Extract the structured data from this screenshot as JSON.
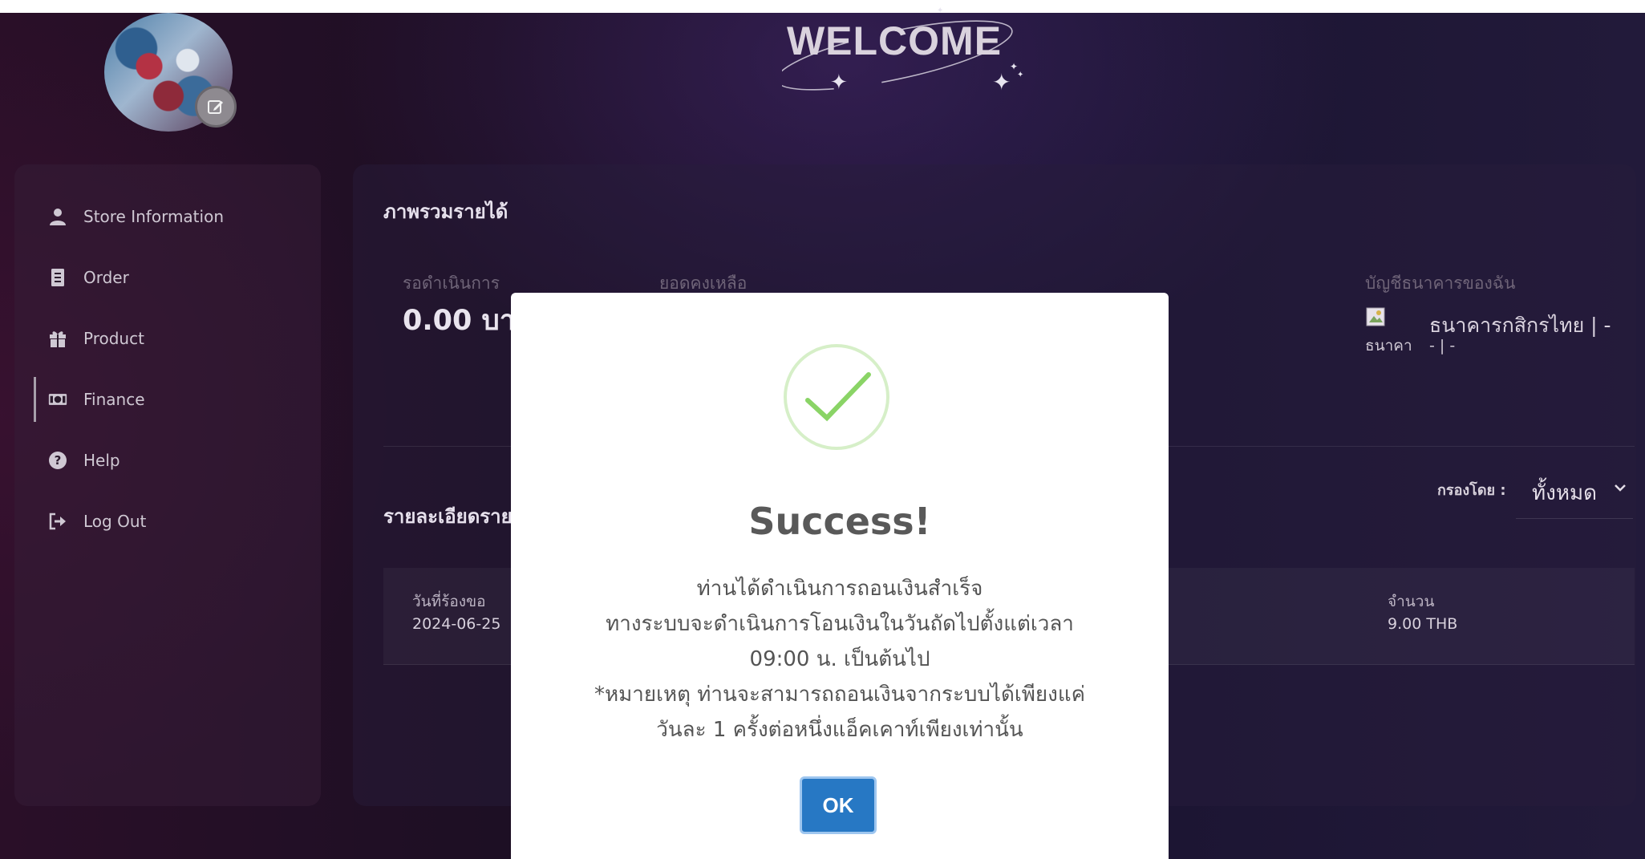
{
  "header": {
    "title": "WELCOME"
  },
  "sidebar": {
    "items": [
      {
        "label": "Store Information",
        "icon": "user-icon"
      },
      {
        "label": "Order",
        "icon": "document-icon"
      },
      {
        "label": "Product",
        "icon": "gift-icon"
      },
      {
        "label": "Finance",
        "icon": "money-icon",
        "active": true
      },
      {
        "label": "Help",
        "icon": "question-icon"
      },
      {
        "label": "Log Out",
        "icon": "logout-icon"
      }
    ]
  },
  "main": {
    "overview_title": "ภาพรวมรายได้",
    "pending_label": "รอดำเนินการ",
    "pending_value": "0.00 บา",
    "balance_label": "ยอดคงเหลือ",
    "bank_label": "บัญชีธนาคารของฉัน",
    "bank_name": "ธนาคารกสิกรไทย | -",
    "bank_img_alt": "ธนาคา",
    "bank_extra": "- | -",
    "details_title": "รายละเอียดราย",
    "filter_label": "กรองโดย :",
    "filter_value": "ทั้งหมด",
    "table": {
      "col_date": "วันที่ร้องขอ",
      "col_amount": "จำนวน",
      "row_date": "2024-06-25",
      "row_amount": "9.00 THB"
    }
  },
  "modal": {
    "title": "Success!",
    "lines": [
      "ท่านได้ดำเนินการถอนเงินสำเร็จ",
      "ทางระบบจะดำเนินการโอนเงินในวันถัดไปตั้งแต่เวลา",
      "09:00 น. เป็นต้นไป",
      "*หมายเหตุ ท่านจะสามารถถอนเงินจากระบบได้เพียงแค่",
      "วันละ 1 ครั้งต่อหนึ่งแอ็คเคาท์เพียงเท่านั้น"
    ],
    "ok_label": "OK"
  },
  "colors": {
    "accent_button": "#2778c4",
    "success_check": "#8ad466"
  }
}
